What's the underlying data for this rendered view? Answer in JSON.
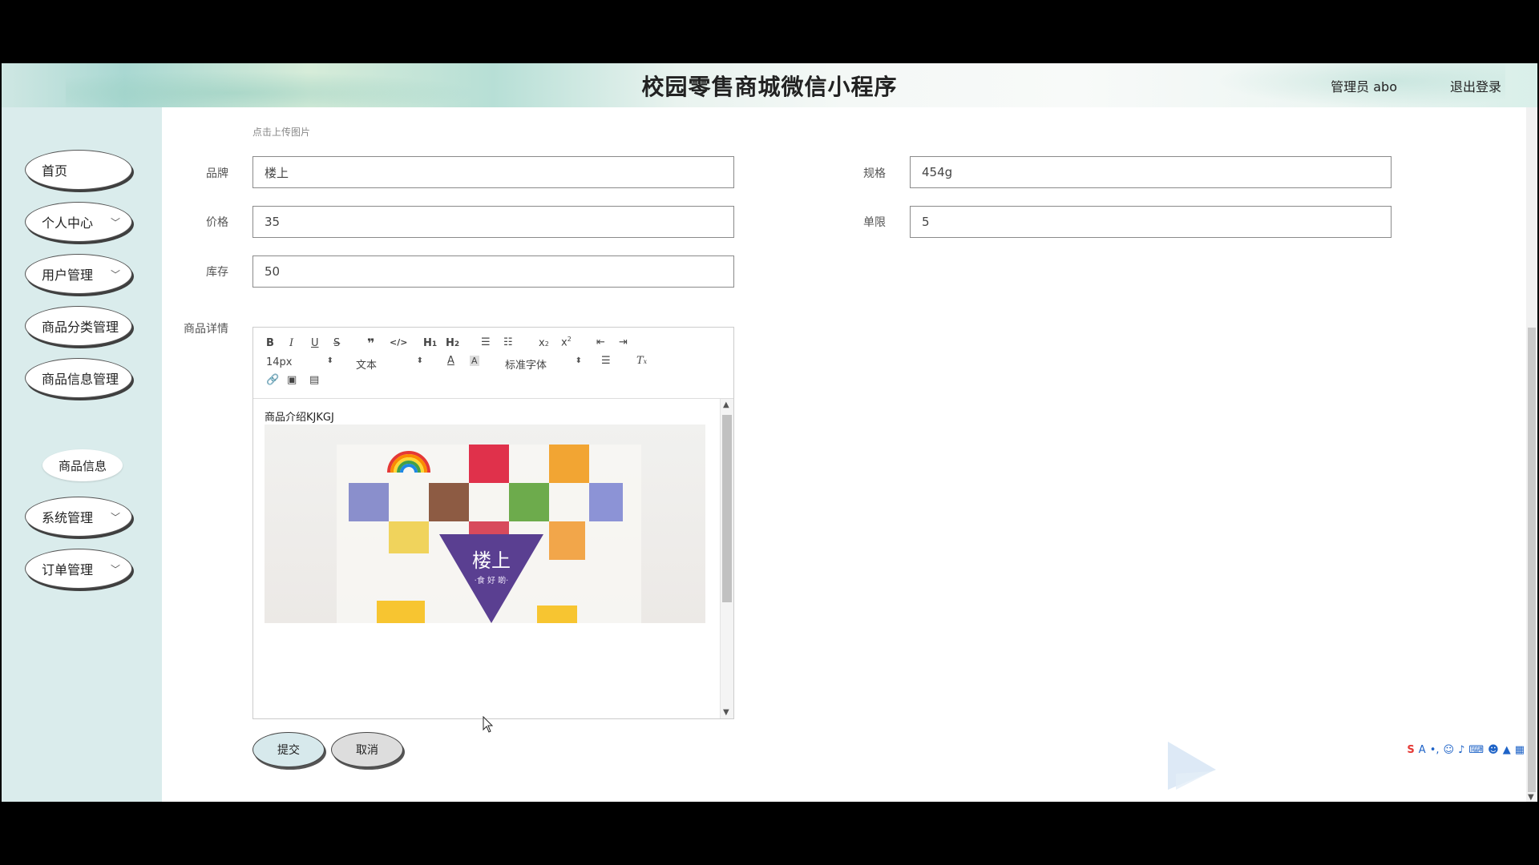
{
  "header": {
    "title": "校园零售商城微信小程序",
    "user": "管理员 abo",
    "logout": "退出登录"
  },
  "sidebar": {
    "items": [
      {
        "label": "首页",
        "has_chevron": false
      },
      {
        "label": "个人中心",
        "has_chevron": true
      },
      {
        "label": "用户管理",
        "has_chevron": true
      },
      {
        "label": "商品分类管理",
        "has_chevron": false
      },
      {
        "label": "商品信息管理",
        "has_chevron": false
      },
      {
        "label": "系统管理",
        "has_chevron": true
      },
      {
        "label": "订单管理",
        "has_chevron": true
      }
    ],
    "subitem": "商品信息"
  },
  "form": {
    "upload_hint": "点击上传图片",
    "brand_label": "品牌",
    "brand_value": "楼上",
    "spec_label": "规格",
    "spec_value": "454g",
    "price_label": "价格",
    "price_value": "35",
    "limit_label": "单限",
    "limit_value": "5",
    "stock_label": "库存",
    "stock_value": "50",
    "detail_label": "商品详情"
  },
  "editor": {
    "font_size": "14px",
    "format": "文本",
    "font_family": "标准字体",
    "content_text": "商品介绍KJKGJ",
    "image_brand": "楼上",
    "image_slogan": "·食 好 啲·"
  },
  "buttons": {
    "submit": "提交",
    "cancel": "取消"
  },
  "colors": {
    "sidebar_bg": "#daecec",
    "submit_bg": "#d7e9ec",
    "cancel_bg": "#dddddd",
    "package_purple": "#5a3f91"
  }
}
